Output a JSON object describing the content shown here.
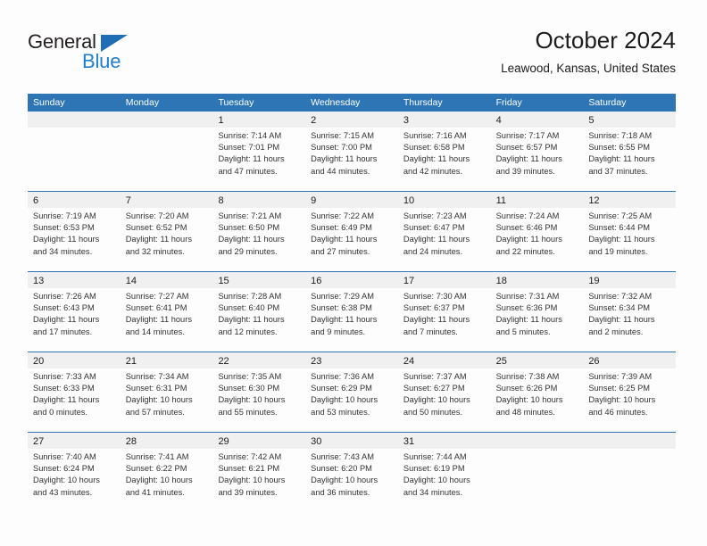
{
  "brand": {
    "name_top": "General",
    "name_bottom": "Blue",
    "triangle_icon": "triangle-icon",
    "color_dark": "#231f20",
    "color_blue": "#1f7fd0"
  },
  "header": {
    "title": "October 2024",
    "subtitle": "Leawood, Kansas, United States"
  },
  "theme": {
    "header_blue": "#2e75b6",
    "day_band_gray": "#f0f0f0",
    "page_background": "#fdfdfd"
  },
  "calendar": {
    "weekdays": [
      "Sunday",
      "Monday",
      "Tuesday",
      "Wednesday",
      "Thursday",
      "Friday",
      "Saturday"
    ],
    "weeks": [
      [
        {
          "day": "",
          "sunrise": "",
          "sunset": "",
          "daylight_line1": "",
          "daylight_line2": ""
        },
        {
          "day": "",
          "sunrise": "",
          "sunset": "",
          "daylight_line1": "",
          "daylight_line2": ""
        },
        {
          "day": "1",
          "sunrise": "Sunrise: 7:14 AM",
          "sunset": "Sunset: 7:01 PM",
          "daylight_line1": "Daylight: 11 hours",
          "daylight_line2": "and 47 minutes."
        },
        {
          "day": "2",
          "sunrise": "Sunrise: 7:15 AM",
          "sunset": "Sunset: 7:00 PM",
          "daylight_line1": "Daylight: 11 hours",
          "daylight_line2": "and 44 minutes."
        },
        {
          "day": "3",
          "sunrise": "Sunrise: 7:16 AM",
          "sunset": "Sunset: 6:58 PM",
          "daylight_line1": "Daylight: 11 hours",
          "daylight_line2": "and 42 minutes."
        },
        {
          "day": "4",
          "sunrise": "Sunrise: 7:17 AM",
          "sunset": "Sunset: 6:57 PM",
          "daylight_line1": "Daylight: 11 hours",
          "daylight_line2": "and 39 minutes."
        },
        {
          "day": "5",
          "sunrise": "Sunrise: 7:18 AM",
          "sunset": "Sunset: 6:55 PM",
          "daylight_line1": "Daylight: 11 hours",
          "daylight_line2": "and 37 minutes."
        }
      ],
      [
        {
          "day": "6",
          "sunrise": "Sunrise: 7:19 AM",
          "sunset": "Sunset: 6:53 PM",
          "daylight_line1": "Daylight: 11 hours",
          "daylight_line2": "and 34 minutes."
        },
        {
          "day": "7",
          "sunrise": "Sunrise: 7:20 AM",
          "sunset": "Sunset: 6:52 PM",
          "daylight_line1": "Daylight: 11 hours",
          "daylight_line2": "and 32 minutes."
        },
        {
          "day": "8",
          "sunrise": "Sunrise: 7:21 AM",
          "sunset": "Sunset: 6:50 PM",
          "daylight_line1": "Daylight: 11 hours",
          "daylight_line2": "and 29 minutes."
        },
        {
          "day": "9",
          "sunrise": "Sunrise: 7:22 AM",
          "sunset": "Sunset: 6:49 PM",
          "daylight_line1": "Daylight: 11 hours",
          "daylight_line2": "and 27 minutes."
        },
        {
          "day": "10",
          "sunrise": "Sunrise: 7:23 AM",
          "sunset": "Sunset: 6:47 PM",
          "daylight_line1": "Daylight: 11 hours",
          "daylight_line2": "and 24 minutes."
        },
        {
          "day": "11",
          "sunrise": "Sunrise: 7:24 AM",
          "sunset": "Sunset: 6:46 PM",
          "daylight_line1": "Daylight: 11 hours",
          "daylight_line2": "and 22 minutes."
        },
        {
          "day": "12",
          "sunrise": "Sunrise: 7:25 AM",
          "sunset": "Sunset: 6:44 PM",
          "daylight_line1": "Daylight: 11 hours",
          "daylight_line2": "and 19 minutes."
        }
      ],
      [
        {
          "day": "13",
          "sunrise": "Sunrise: 7:26 AM",
          "sunset": "Sunset: 6:43 PM",
          "daylight_line1": "Daylight: 11 hours",
          "daylight_line2": "and 17 minutes."
        },
        {
          "day": "14",
          "sunrise": "Sunrise: 7:27 AM",
          "sunset": "Sunset: 6:41 PM",
          "daylight_line1": "Daylight: 11 hours",
          "daylight_line2": "and 14 minutes."
        },
        {
          "day": "15",
          "sunrise": "Sunrise: 7:28 AM",
          "sunset": "Sunset: 6:40 PM",
          "daylight_line1": "Daylight: 11 hours",
          "daylight_line2": "and 12 minutes."
        },
        {
          "day": "16",
          "sunrise": "Sunrise: 7:29 AM",
          "sunset": "Sunset: 6:38 PM",
          "daylight_line1": "Daylight: 11 hours",
          "daylight_line2": "and 9 minutes."
        },
        {
          "day": "17",
          "sunrise": "Sunrise: 7:30 AM",
          "sunset": "Sunset: 6:37 PM",
          "daylight_line1": "Daylight: 11 hours",
          "daylight_line2": "and 7 minutes."
        },
        {
          "day": "18",
          "sunrise": "Sunrise: 7:31 AM",
          "sunset": "Sunset: 6:36 PM",
          "daylight_line1": "Daylight: 11 hours",
          "daylight_line2": "and 5 minutes."
        },
        {
          "day": "19",
          "sunrise": "Sunrise: 7:32 AM",
          "sunset": "Sunset: 6:34 PM",
          "daylight_line1": "Daylight: 11 hours",
          "daylight_line2": "and 2 minutes."
        }
      ],
      [
        {
          "day": "20",
          "sunrise": "Sunrise: 7:33 AM",
          "sunset": "Sunset: 6:33 PM",
          "daylight_line1": "Daylight: 11 hours",
          "daylight_line2": "and 0 minutes."
        },
        {
          "day": "21",
          "sunrise": "Sunrise: 7:34 AM",
          "sunset": "Sunset: 6:31 PM",
          "daylight_line1": "Daylight: 10 hours",
          "daylight_line2": "and 57 minutes."
        },
        {
          "day": "22",
          "sunrise": "Sunrise: 7:35 AM",
          "sunset": "Sunset: 6:30 PM",
          "daylight_line1": "Daylight: 10 hours",
          "daylight_line2": "and 55 minutes."
        },
        {
          "day": "23",
          "sunrise": "Sunrise: 7:36 AM",
          "sunset": "Sunset: 6:29 PM",
          "daylight_line1": "Daylight: 10 hours",
          "daylight_line2": "and 53 minutes."
        },
        {
          "day": "24",
          "sunrise": "Sunrise: 7:37 AM",
          "sunset": "Sunset: 6:27 PM",
          "daylight_line1": "Daylight: 10 hours",
          "daylight_line2": "and 50 minutes."
        },
        {
          "day": "25",
          "sunrise": "Sunrise: 7:38 AM",
          "sunset": "Sunset: 6:26 PM",
          "daylight_line1": "Daylight: 10 hours",
          "daylight_line2": "and 48 minutes."
        },
        {
          "day": "26",
          "sunrise": "Sunrise: 7:39 AM",
          "sunset": "Sunset: 6:25 PM",
          "daylight_line1": "Daylight: 10 hours",
          "daylight_line2": "and 46 minutes."
        }
      ],
      [
        {
          "day": "27",
          "sunrise": "Sunrise: 7:40 AM",
          "sunset": "Sunset: 6:24 PM",
          "daylight_line1": "Daylight: 10 hours",
          "daylight_line2": "and 43 minutes."
        },
        {
          "day": "28",
          "sunrise": "Sunrise: 7:41 AM",
          "sunset": "Sunset: 6:22 PM",
          "daylight_line1": "Daylight: 10 hours",
          "daylight_line2": "and 41 minutes."
        },
        {
          "day": "29",
          "sunrise": "Sunrise: 7:42 AM",
          "sunset": "Sunset: 6:21 PM",
          "daylight_line1": "Daylight: 10 hours",
          "daylight_line2": "and 39 minutes."
        },
        {
          "day": "30",
          "sunrise": "Sunrise: 7:43 AM",
          "sunset": "Sunset: 6:20 PM",
          "daylight_line1": "Daylight: 10 hours",
          "daylight_line2": "and 36 minutes."
        },
        {
          "day": "31",
          "sunrise": "Sunrise: 7:44 AM",
          "sunset": "Sunset: 6:19 PM",
          "daylight_line1": "Daylight: 10 hours",
          "daylight_line2": "and 34 minutes."
        },
        {
          "day": "",
          "sunrise": "",
          "sunset": "",
          "daylight_line1": "",
          "daylight_line2": ""
        },
        {
          "day": "",
          "sunrise": "",
          "sunset": "",
          "daylight_line1": "",
          "daylight_line2": ""
        }
      ]
    ]
  }
}
